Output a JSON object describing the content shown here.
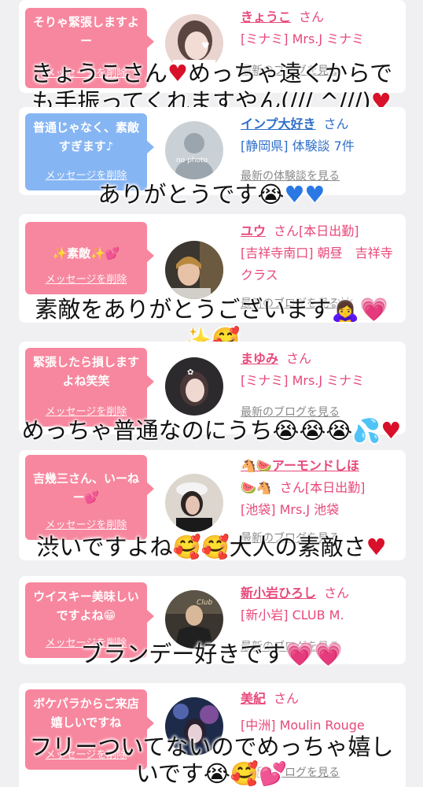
{
  "delete_label": "メッセージを削除",
  "san": "さん",
  "cards": [
    {
      "message": "そりゃ緊張しますよー",
      "name": "きょうこ",
      "shop": "[ミナミ] Mrs.J ミナミ",
      "latest": "最新のブログを見る",
      "caption_l1": "きょうこさん",
      "caption_l1b": "めっちゃ遠くからで",
      "caption_l2": "も手振ってくれますやん(/// ^///)"
    },
    {
      "message": "普通じゃなく、素敵すぎます♪",
      "name": "インプ大好き",
      "shop": "[静岡県] 体験談 7件",
      "latest": "最新の体験談を見る",
      "avatar_text": "no photo",
      "caption_l1": "ありがとうです😭"
    },
    {
      "message": "✨素敵✨💕",
      "name": "ユウ",
      "san_suffix": "[本日出勤]",
      "shop": "[吉祥寺南口] 朝昼　吉祥寺クラス",
      "latest": "最新のブログを見る",
      "caption_l1": "素敵をありがとうございます🙇‍♀️",
      "caption_l2": "✨🥰"
    },
    {
      "message": "緊張したら損しますよね笑笑",
      "name": "まゆみ",
      "shop": "[ミナミ] Mrs.J ミナミ",
      "latest": "最新のブログを見る",
      "caption_l1": "めっちゃ普通なのにうち😭😭😭💦"
    },
    {
      "message": "吉幾三さん、いーねー💕",
      "name": "🐴🍉アーモンドしほ",
      "name2": "🍉🐴",
      "san_suffix": "[本日出勤]",
      "shop": "[池袋] Mrs.J 池袋",
      "latest": "最新のブログを見る",
      "caption_l1": "渋いですよね🥰🥰大人の素敵さ"
    },
    {
      "message": "ウイスキー美味しいですよね😁",
      "name": "新小岩ひろし",
      "shop": "[新小岩] CLUB M.",
      "latest": "最新のブログを見る",
      "caption_l1": "ブランデー好きです💗💗"
    },
    {
      "message": "ボケパラからご来店嬉しいですね",
      "name": "美紀",
      "shop": "[中洲] Moulin Rouge",
      "latest": "最新のブログを見る",
      "caption_l1": "フリーついてないのでめっちゃ嬉し",
      "caption_l2": "いです😭🥰💕"
    }
  ],
  "colors": {
    "pink_bubble": "#f7879e",
    "blue_bubble": "#86b5f3",
    "name_pink": "#e8487a",
    "name_blue": "#2f6fc9",
    "page_bg": "#f0f0f2"
  }
}
